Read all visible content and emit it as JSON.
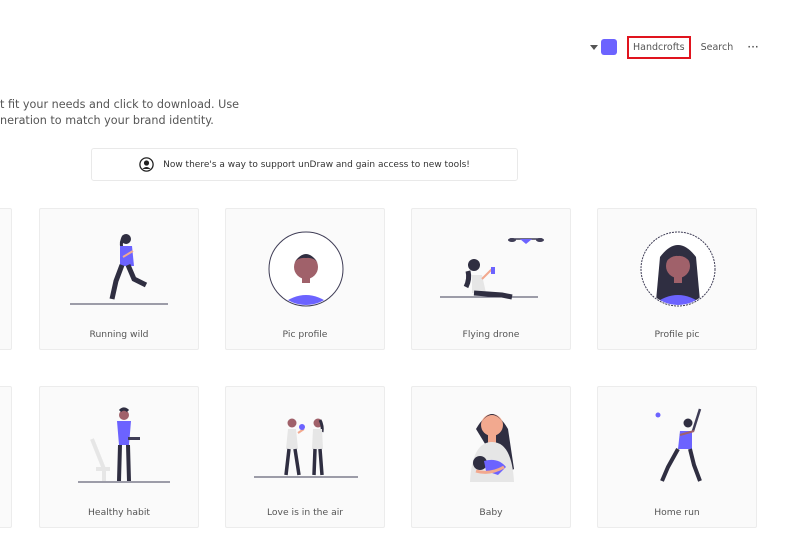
{
  "nav": {
    "highlighted_label": "Handcrofts",
    "search_label": "Search",
    "more_label": "···",
    "accent_color": "#6c63ff",
    "highlight_border_color": "#e0141e"
  },
  "intro": {
    "line1": "t fit your needs and click to download. Use",
    "line2": "neration to match your brand identity."
  },
  "banner": {
    "text": "Now there's a way to support unDraw and gain access to new tools!"
  },
  "illustrations": [
    {
      "title": "Running wild"
    },
    {
      "title": "Pic profile"
    },
    {
      "title": "Flying drone"
    },
    {
      "title": "Profile pic"
    },
    {
      "title": "Healthy habit"
    },
    {
      "title": "Love is in the air"
    },
    {
      "title": "Baby"
    },
    {
      "title": "Home run"
    }
  ]
}
